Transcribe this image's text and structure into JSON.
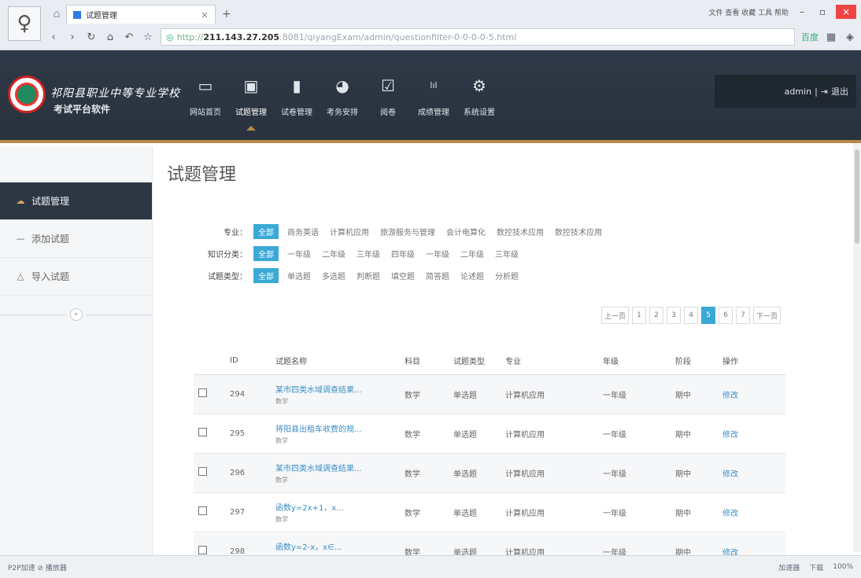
{
  "browser": {
    "tab_title": "试题管理",
    "url_prefix": "http://",
    "url_host": "211.143.27.205",
    "url_path": ":8081/qiyangExam/admin/questionfilter-0-0-0-0-5.html",
    "window_right_text": "文件  查看  收藏  工具  帮助",
    "ext_text": "百度"
  },
  "header": {
    "school_name": "祁阳县职业中等专业学校",
    "system_name": "考试平台软件",
    "menu": [
      {
        "label": "网站首页"
      },
      {
        "label": "试题管理"
      },
      {
        "label": "试卷管理"
      },
      {
        "label": "考务安排"
      },
      {
        "label": "阅卷"
      },
      {
        "label": "成绩管理"
      },
      {
        "label": "系统设置"
      }
    ],
    "user": "admin",
    "logout": "退出"
  },
  "sidebar": {
    "items": [
      {
        "label": "试题管理"
      },
      {
        "label": "添加试题"
      },
      {
        "label": "导入试题"
      }
    ]
  },
  "main": {
    "title": "试题管理",
    "filters": {
      "major": {
        "label": "专业：",
        "options": [
          "全部",
          "商务英语",
          "计算机应用",
          "旅游服务与管理",
          "会计电算化",
          "数控技术应用",
          "数控技术应用"
        ]
      },
      "grade": {
        "label": "知识分类：",
        "options": [
          "全部",
          "一年级",
          "二年级",
          "三年级",
          "四年级",
          "一年级",
          "二年级",
          "三年级"
        ]
      },
      "type": {
        "label": "试题类型：",
        "options": [
          "全部",
          "单选题",
          "多选题",
          "判断题",
          "填空题",
          "简答题",
          "论述题",
          "分析题"
        ]
      }
    },
    "pager": [
      "上一页",
      "1",
      "2",
      "3",
      "4",
      "5",
      "6",
      "7",
      "下一页"
    ],
    "table": {
      "headers": [
        "",
        "ID",
        "试题名称",
        "科目",
        "试题类型",
        "专业",
        "年级",
        "阶段",
        "操作"
      ],
      "rows": [
        {
          "id": "294",
          "name": "某市四类水域调查结果...",
          "sub": "数学",
          "subject": "数学",
          "type": "单选题",
          "major": "计算机应用",
          "grade": "一年级",
          "stage": "期中",
          "op": "修改"
        },
        {
          "id": "295",
          "name": "将阳县出租车收费的规...",
          "sub": "数学",
          "subject": "数学",
          "type": "单选题",
          "major": "计算机应用",
          "grade": "一年级",
          "stage": "期中",
          "op": "修改"
        },
        {
          "id": "296",
          "name": "某市四类水域调查结果...",
          "sub": "数学",
          "subject": "数学",
          "type": "单选题",
          "major": "计算机应用",
          "grade": "一年级",
          "stage": "期中",
          "op": "修改"
        },
        {
          "id": "297",
          "name": "函数y=2x+1，x...",
          "sub": "数学",
          "subject": "数学",
          "type": "单选题",
          "major": "计算机应用",
          "grade": "一年级",
          "stage": "期中",
          "op": "修改"
        },
        {
          "id": "298",
          "name": "函数y=2-x，x∈...",
          "sub": "数学",
          "subject": "数学",
          "type": "单选题",
          "major": "计算机应用",
          "grade": "一年级",
          "stage": "期中",
          "op": "修改"
        }
      ]
    }
  },
  "statusbar": {
    "left": "P2P加速  ⊘ 播放器",
    "right": [
      "加速器",
      "下载",
      "100%"
    ]
  }
}
